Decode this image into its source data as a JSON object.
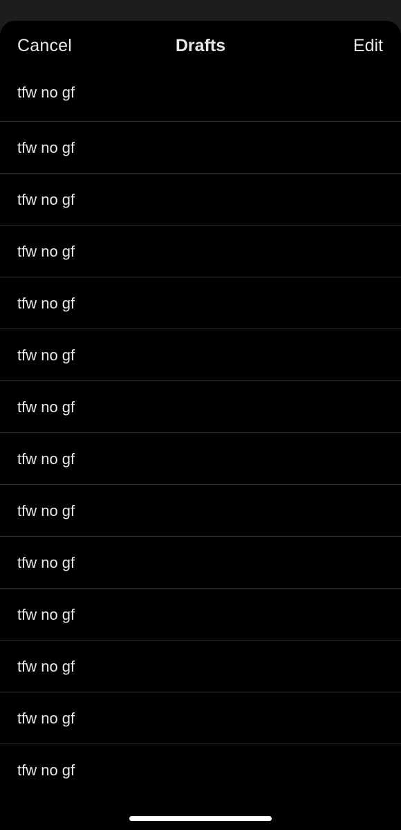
{
  "header": {
    "cancel_label": "Cancel",
    "title": "Drafts",
    "edit_label": "Edit"
  },
  "drafts": [
    {
      "text": "tfw no gf"
    },
    {
      "text": "tfw no gf"
    },
    {
      "text": "tfw no gf"
    },
    {
      "text": "tfw no gf"
    },
    {
      "text": "tfw no gf"
    },
    {
      "text": "tfw no gf"
    },
    {
      "text": "tfw no gf"
    },
    {
      "text": "tfw no gf"
    },
    {
      "text": "tfw no gf"
    },
    {
      "text": "tfw no gf"
    },
    {
      "text": "tfw no gf"
    },
    {
      "text": "tfw no gf"
    },
    {
      "text": "tfw no gf"
    },
    {
      "text": "tfw no gf"
    }
  ],
  "colors": {
    "background": "#000000",
    "text": "#e7e9ea",
    "divider": "#2f3336",
    "backdrop": "#1c1d1f"
  }
}
